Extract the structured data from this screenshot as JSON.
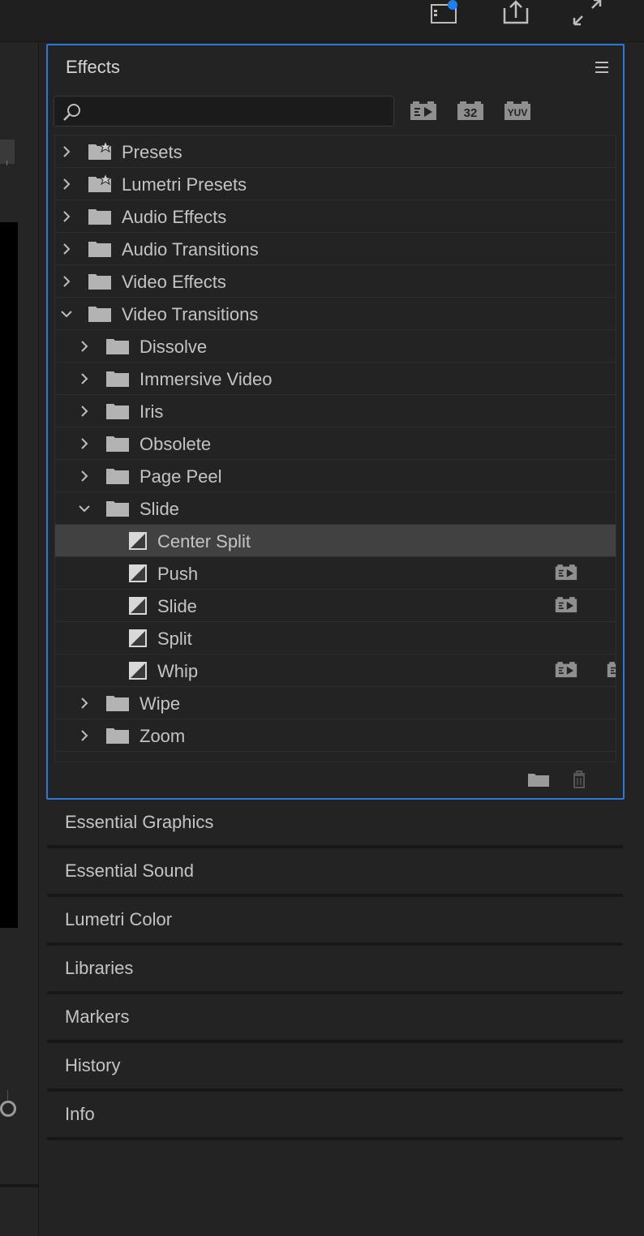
{
  "effects_panel": {
    "title": "Effects",
    "search": {
      "value": "",
      "placeholder": ""
    },
    "filters": {
      "accelerated_icon": "accelerated-effects-icon",
      "bit32_label": "32",
      "yuv_label": "YUV"
    },
    "tree": [
      {
        "label": "Presets",
        "type": "preset-folder",
        "expanded": false
      },
      {
        "label": "Lumetri Presets",
        "type": "preset-folder",
        "expanded": false
      },
      {
        "label": "Audio Effects",
        "type": "folder",
        "expanded": false
      },
      {
        "label": "Audio Transitions",
        "type": "folder",
        "expanded": false
      },
      {
        "label": "Video Effects",
        "type": "folder",
        "expanded": false
      },
      {
        "label": "Video Transitions",
        "type": "folder",
        "expanded": true
      },
      {
        "label": "Dissolve",
        "type": "folder",
        "expanded": false
      },
      {
        "label": "Immersive Video",
        "type": "folder",
        "expanded": false
      },
      {
        "label": "Iris",
        "type": "folder",
        "expanded": false
      },
      {
        "label": "Obsolete",
        "type": "folder",
        "expanded": false
      },
      {
        "label": "Page Peel",
        "type": "folder",
        "expanded": false
      },
      {
        "label": "Slide",
        "type": "folder",
        "expanded": true
      },
      {
        "label": "Center Split",
        "type": "transition",
        "selected": true
      },
      {
        "label": "Push",
        "type": "transition",
        "accelerated": true
      },
      {
        "label": "Slide",
        "type": "transition",
        "accelerated": true
      },
      {
        "label": "Split",
        "type": "transition"
      },
      {
        "label": "Whip",
        "type": "transition",
        "accelerated": true
      },
      {
        "label": "Wipe",
        "type": "folder",
        "expanded": false
      },
      {
        "label": "Zoom",
        "type": "folder",
        "expanded": false
      }
    ]
  },
  "collapsed_panels": [
    "Essential Graphics",
    "Essential Sound",
    "Lumetri Color",
    "Libraries",
    "Markers",
    "History",
    "Info"
  ],
  "colors": {
    "accent": "#2d7ad6",
    "notification_dot": "#1f7ff0",
    "background": "#232323"
  }
}
